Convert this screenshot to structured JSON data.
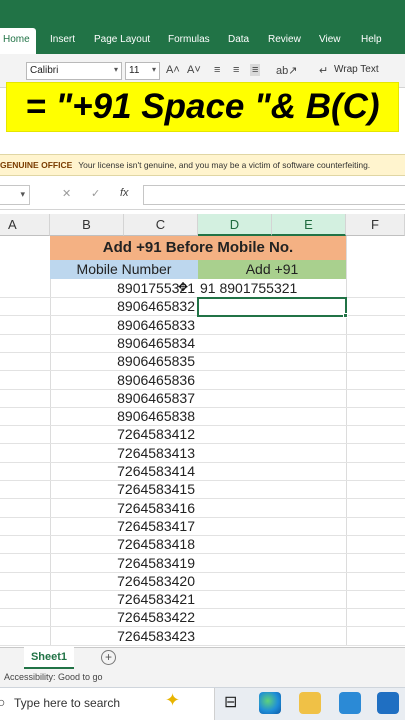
{
  "ribbon": {
    "tabs": [
      "Home",
      "Insert",
      "Page Layout",
      "Formulas",
      "Data",
      "Review",
      "View",
      "Help"
    ],
    "font_name": "Calibri",
    "font_size": "11",
    "wrap_text_label": "Wrap Text"
  },
  "banner": {
    "text": "= \"+91 Space \"& B(C)"
  },
  "license": {
    "title": "GENUINE OFFICE",
    "message": "Your license isn't genuine, and you may be a victim of software counterfeiting."
  },
  "formula_bar": {
    "fx": "fx"
  },
  "columns": [
    "A",
    "B",
    "C",
    "D",
    "E",
    "F"
  ],
  "sheet": {
    "title": "Add +91 Before Mobile No.",
    "header_mobile": "Mobile Number",
    "header_result": "Add +91",
    "numbers": [
      "8901755321",
      "8906465832",
      "8906465833",
      "8906465834",
      "8906465835",
      "8906465836",
      "8906465837",
      "8906465838",
      "7264583412",
      "7264583413",
      "7264583414",
      "7264583415",
      "7264583416",
      "7264583417",
      "7264583418",
      "7264583419",
      "7264583420",
      "7264583421",
      "7264583422",
      "7264583423"
    ],
    "results": [
      "91 8901755321"
    ]
  },
  "sheet_tabs": {
    "active": "Sheet1",
    "add": "+"
  },
  "status": {
    "accessibility": "Accessibility: Good to go"
  },
  "taskbar": {
    "search_placeholder": "Type here to search"
  },
  "colors": {
    "excel_green": "#217346",
    "banner_yellow": "#ffff00",
    "title_orange": "#f4b183",
    "header_blue": "#bdd7ee",
    "header_green": "#a9d08e"
  }
}
